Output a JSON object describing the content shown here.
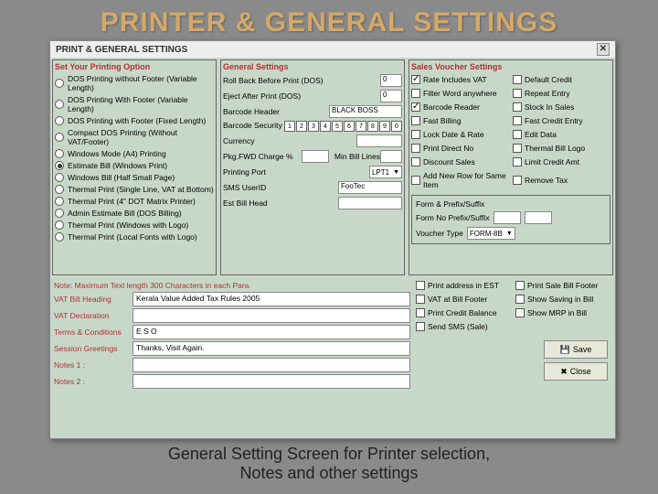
{
  "slide": {
    "title": "PRINTER & GENERAL SETTINGS",
    "caption_a": "General Setting Screen for Printer selection,",
    "caption_b": "Notes and other settings"
  },
  "dialog": {
    "title": "PRINT & GENERAL SETTINGS",
    "close": "✕"
  },
  "print_opt": {
    "title": "Set Your Printing Option",
    "opts": [
      "DOS Printing without Footer (Variable Length)",
      "DOS Printing With Footer (Variable Length)",
      "DOS Printing with Footer (Fixed Length)",
      "Compact DOS Printing (Without VAT/Footer)",
      "Windows Mode (A4) Printing",
      "Estimate Bill (Windows Print)",
      "Windows Bill (Half Small Page)",
      "Thermal Print (Single Line, VAT at Bottom)",
      "Thermal Print (4\" DOT Matrix Printer)",
      "Admin Estimate Bill (DOS Billing)",
      "Thermal Print (Windows with Logo)",
      "Thermal Print (Local Fonts with Logo)"
    ],
    "sel": 5
  },
  "general": {
    "title": "General Settings",
    "roll_back": "Roll Back Before Print (DOS)",
    "roll_back_v": "0",
    "eject": "Eject After Print (DOS)",
    "eject_v": "0",
    "barcode_header": "Barcode Header",
    "barcode_header_v": "BLACK BOSS",
    "barcode_sec": "Barcode Security",
    "sec_digits": [
      "1",
      "2",
      "3",
      "4",
      "5",
      "6",
      "7",
      "8",
      "9",
      "0"
    ],
    "currency": "Currency",
    "currency_v": "",
    "pkg_fwd": "Pkg.FWD Charge %",
    "pkg_fwd_v": "",
    "min_bill": "Min Bill Lines",
    "min_bill_v": "",
    "printing_port": "Printing Port",
    "printing_port_v": "LPT1",
    "sms_user": "SMS UserID",
    "sms_user_v": "FooTec",
    "est_bill_head": "Est Bill Head",
    "est_bill_head_v": ""
  },
  "voucher": {
    "title": "Sales Voucher Settings",
    "items": [
      {
        "l": "Rate Includes VAT",
        "c": true
      },
      {
        "l": "Default Credit",
        "c": false
      },
      {
        "l": "Filter Word anywhere",
        "c": false
      },
      {
        "l": "Repeat Entry",
        "c": false
      },
      {
        "l": "Barcode Reader",
        "c": true
      },
      {
        "l": "Stock In Sales",
        "c": false
      },
      {
        "l": "Fast Billing",
        "c": false
      },
      {
        "l": "Fast Credit Entry",
        "c": false
      },
      {
        "l": "Lock Date & Rate",
        "c": false
      },
      {
        "l": "Edit Data",
        "c": false
      },
      {
        "l": "Print Direct No",
        "c": false
      },
      {
        "l": "Thermal Bill Logo",
        "c": false
      },
      {
        "l": "Discount Sales",
        "c": false
      },
      {
        "l": "Limit Credit Amt",
        "c": false
      },
      {
        "l": "Add New Row for Same Item",
        "c": false
      },
      {
        "l": "Remove Tax",
        "c": false
      }
    ],
    "prefix_title": "Form & Prefix/Suffix",
    "prefix_lbl": "Form No Prefix/Suffix",
    "voucher_type": "Voucher Type",
    "voucher_type_v": "FORM-8B",
    "extra": [
      {
        "l": "Print address in EST",
        "c": false
      },
      {
        "l": "Print Sale Bill Footer",
        "c": false
      },
      {
        "l": "VAT at Bill Footer",
        "c": false
      },
      {
        "l": "Show Saving in Bill",
        "c": false
      },
      {
        "l": "Print Credit Balance",
        "c": false
      },
      {
        "l": "Show MRP in Bill",
        "c": false
      },
      {
        "l": "Send SMS (Sale)",
        "c": false
      }
    ]
  },
  "bottom": {
    "note": "Note: Maximum Text length 300 Characters in each Para.",
    "rows": [
      {
        "l": "VAT Bill Heading",
        "v": "Kerala Value Added Tax Rules 2005"
      },
      {
        "l": "VAT Declaration",
        "v": ""
      },
      {
        "l": "Terms & Conditions",
        "v": "E S O"
      },
      {
        "l": "Session Greetings",
        "v": "Thanks, Visit Again."
      },
      {
        "l": "Notes 1 :",
        "v": ""
      },
      {
        "l": "Notes 2 :",
        "v": ""
      }
    ],
    "save": "Save",
    "close": "Close"
  }
}
